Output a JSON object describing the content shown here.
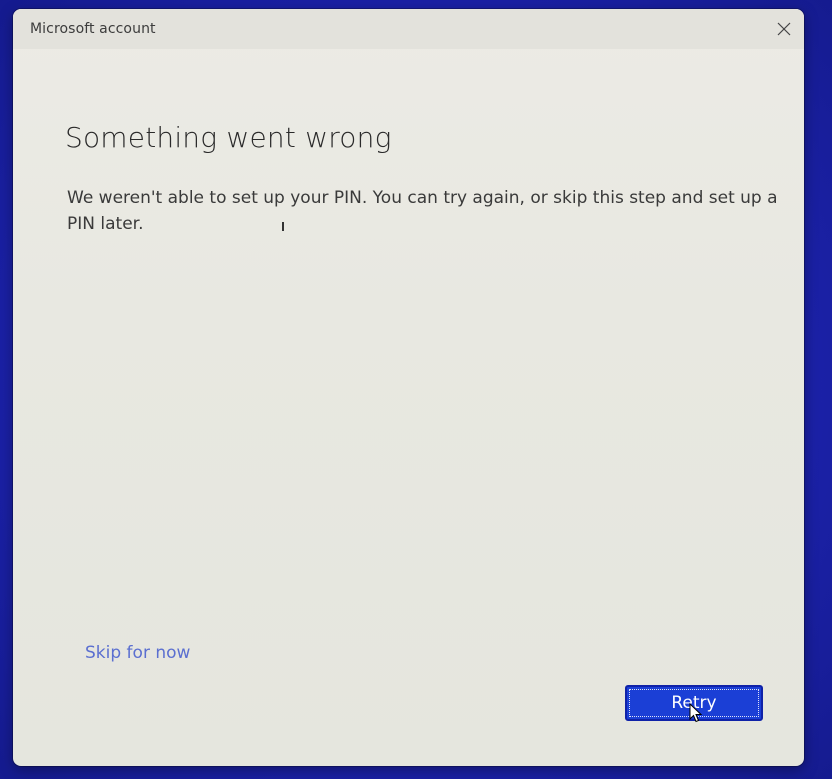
{
  "window": {
    "title": "Microsoft account"
  },
  "content": {
    "heading": "Something went wrong",
    "message": "We weren't able to set up your PIN. You can try again, or skip this step and set up a PIN later."
  },
  "actions": {
    "skip_label": "Skip for now",
    "retry_label": "Retry"
  },
  "icons": {
    "close": "close-icon",
    "cursor": "mouse-pointer-icon"
  },
  "colors": {
    "background": "#1d23b0",
    "dialog": "#e8e8e1",
    "link": "#5b6fd0",
    "primary_button": "#1b3fd6"
  }
}
